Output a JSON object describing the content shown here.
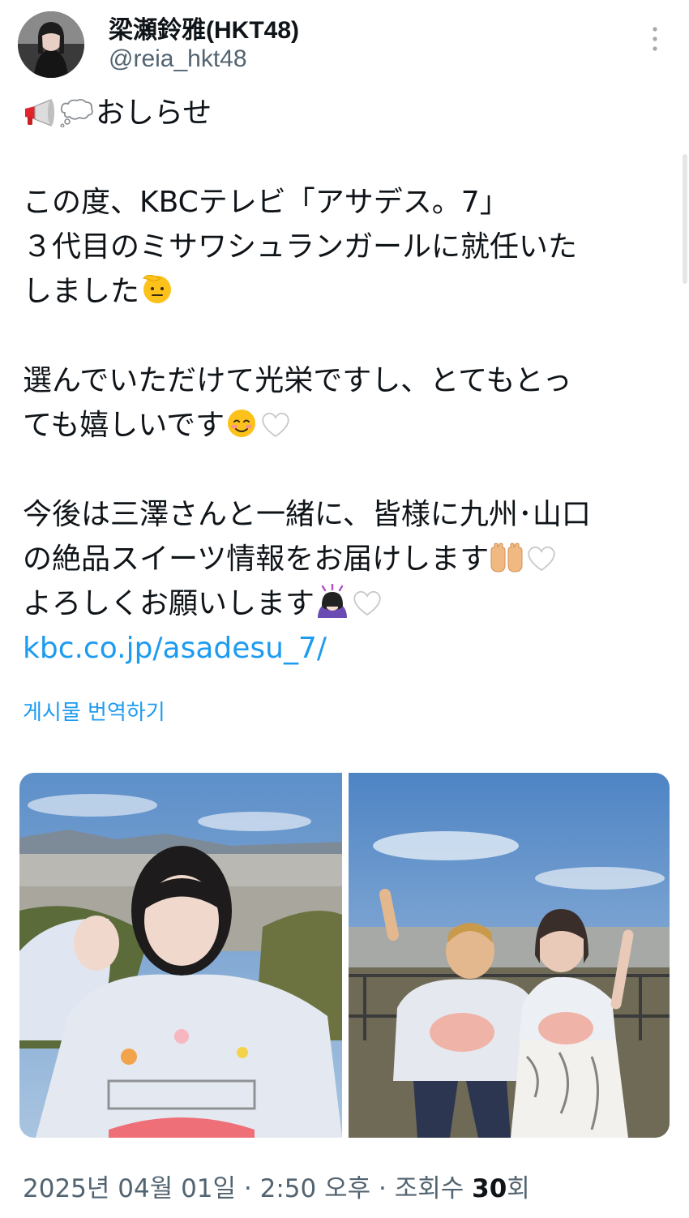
{
  "author": {
    "display_name": "梁瀬鈴雅(HKT48)",
    "handle": "@reia_hkt48"
  },
  "tweet": {
    "line1": "おしらせ",
    "line2": "この度、KBCテレビ「アサデス。7」",
    "line3": "３代目のミサワシュランガールに就任いた",
    "line4": "しました",
    "line5": "選んでいただけて光栄ですし、とてもとっ",
    "line6": "ても嬉しいです",
    "line7": "今後は三澤さんと一緒に、皆様に九州･山口",
    "line8": "の絶品スイーツ情報をお届けします",
    "line9": "よろしくお願いします",
    "link": "kbc.co.jp/asadesu_7/"
  },
  "translate_label": "게시물 번역하기",
  "meta": {
    "date": "2025년 04월 01일",
    "separator": "·",
    "time": "2:50 오후",
    "views_label": "조회수",
    "views_count": "30",
    "views_unit": "회"
  },
  "colors": {
    "link": "#1d9bf0",
    "text": "#0f1419",
    "secondary": "#536471"
  }
}
